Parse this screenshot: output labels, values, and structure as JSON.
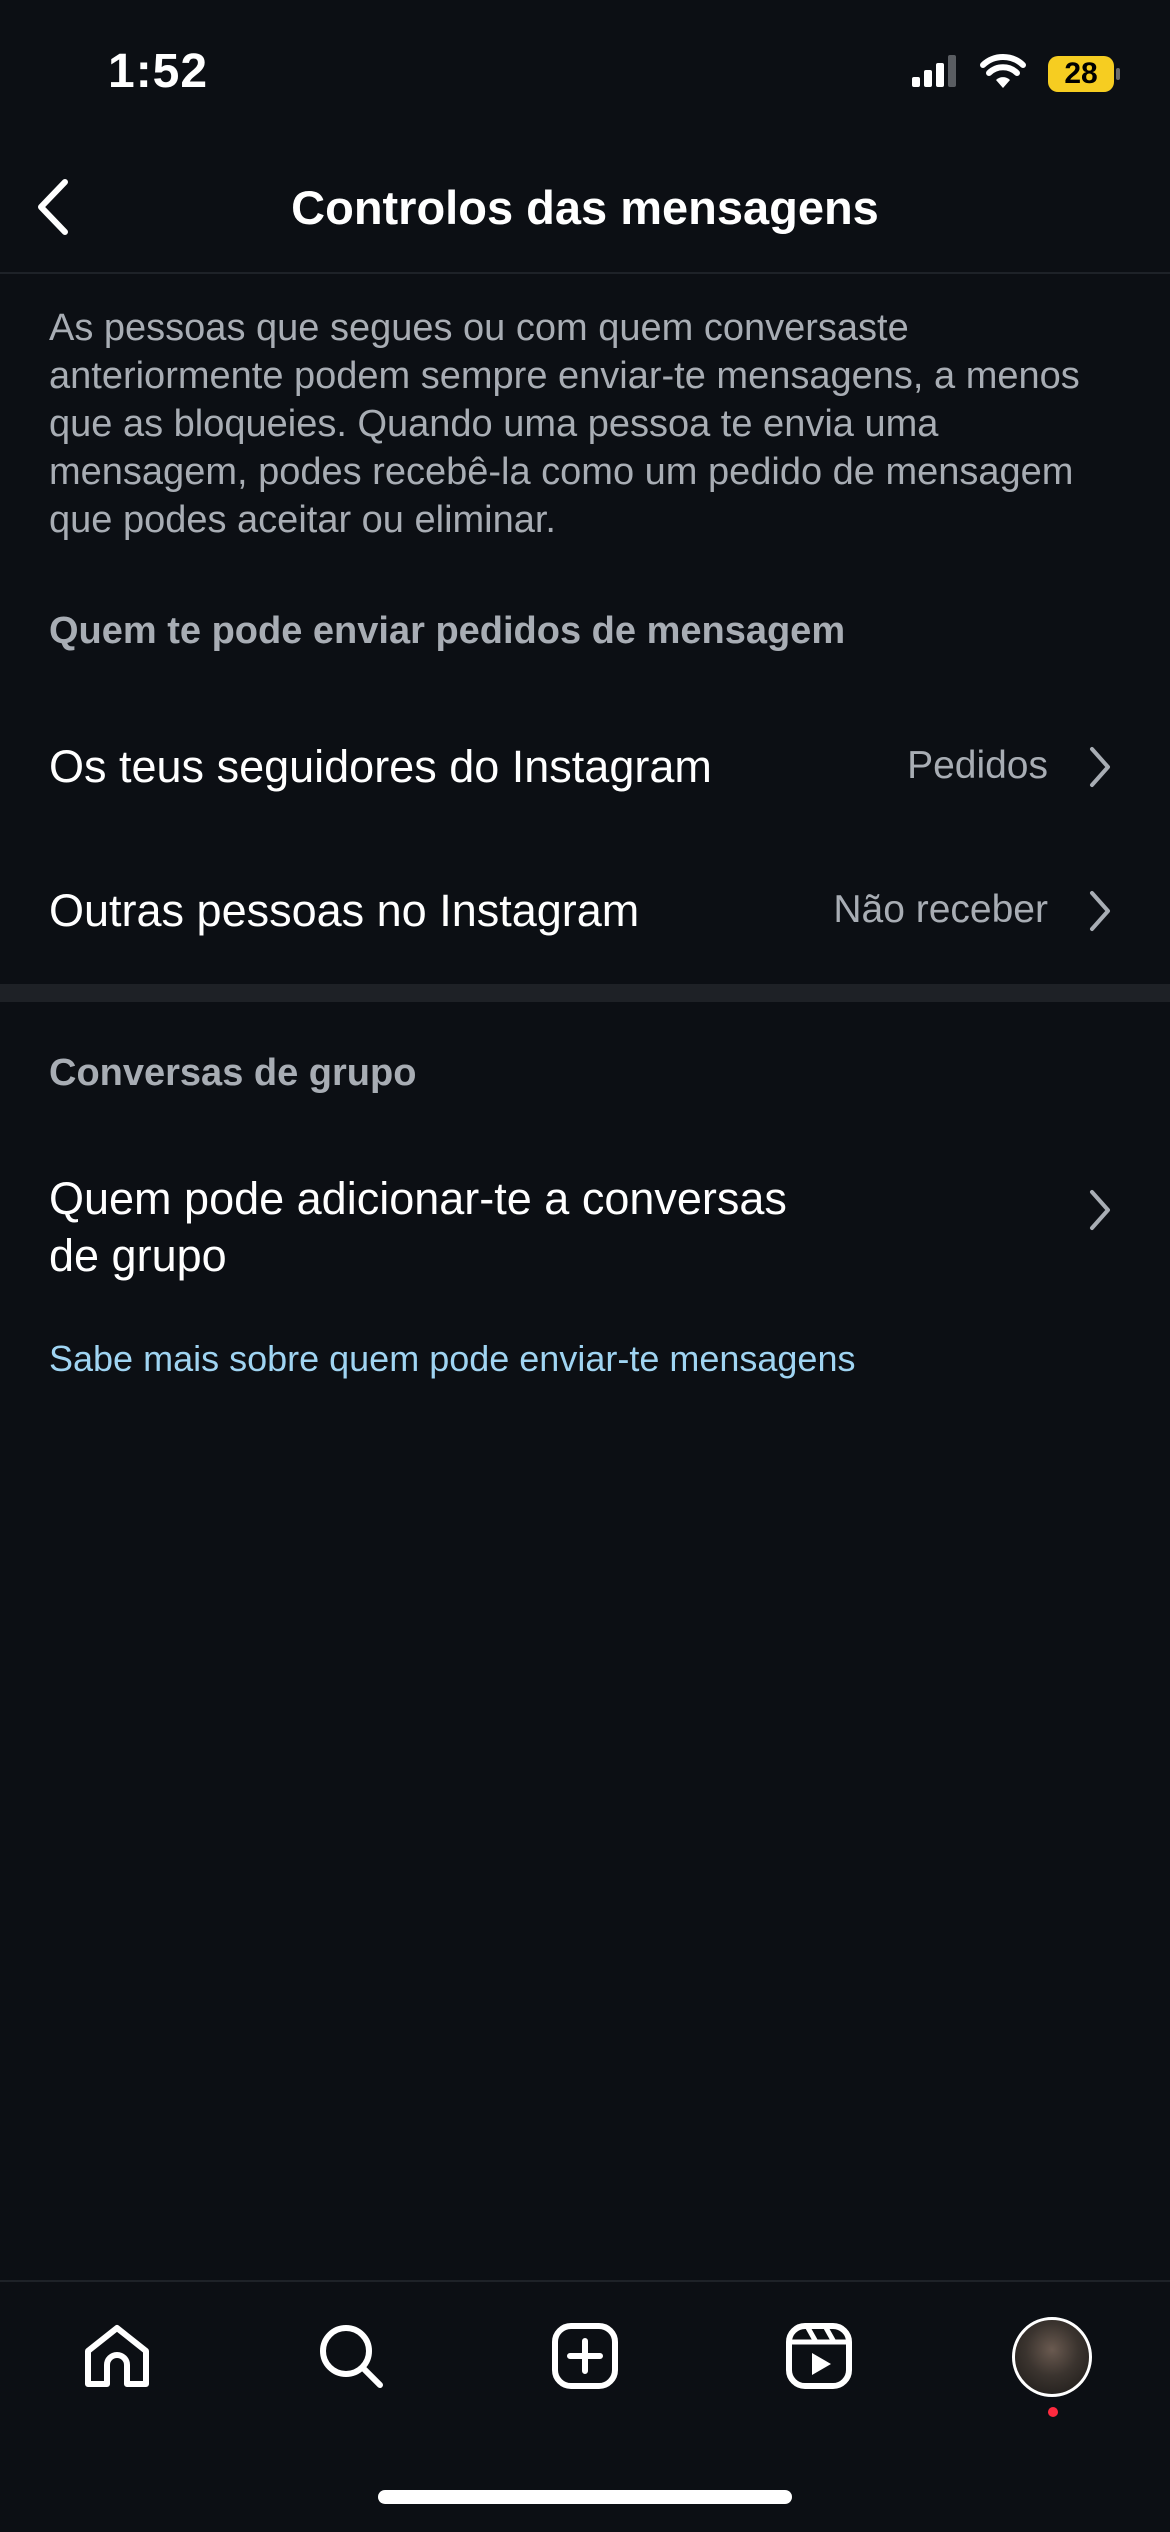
{
  "status_bar": {
    "time": "1:52",
    "battery": "28"
  },
  "header": {
    "title": "Controlos das mensagens"
  },
  "description": "As pessoas que segues ou com quem conversaste anteriormente podem sempre enviar-te mensagens, a menos que as bloqueies. Quando uma pessoa te envia uma mensagem, podes recebê-la como um pedido de mensagem que podes aceitar ou eliminar.",
  "sections": {
    "requests": {
      "title": "Quem te pode enviar pedidos de mensagem",
      "rows": [
        {
          "label": "Os teus seguidores do Instagram",
          "value": "Pedidos"
        },
        {
          "label": "Outras pessoas no Instagram",
          "value": "Não receber"
        }
      ]
    },
    "groups": {
      "title": "Conversas de grupo",
      "rows": [
        {
          "label_line1": "Quem pode adicionar-te a conversas",
          "label_line2": "de grupo"
        }
      ]
    }
  },
  "learn_more": "Sabe mais sobre quem pode enviar-te mensagens",
  "tabbar": {
    "items": [
      "home-icon",
      "search-icon",
      "create-icon",
      "reels-icon",
      "profile-avatar"
    ]
  },
  "colors": {
    "background": "#0c0f14",
    "secondary_text": "#a8adb4",
    "link": "#9fd4f2",
    "battery": "#f6cd21",
    "notification_dot": "#ff2a3f"
  }
}
